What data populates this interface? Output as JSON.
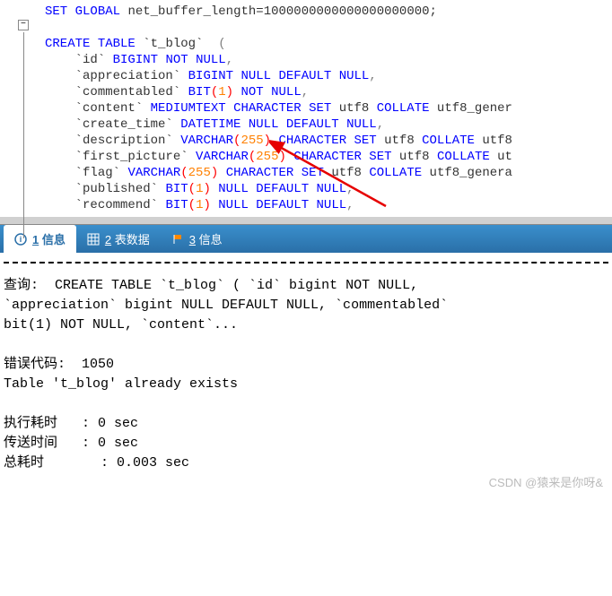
{
  "code": {
    "line1": {
      "set": "SET",
      "global": "GLOBAL",
      "var": "net_buffer_length",
      "val": "1000000000000000000000;"
    },
    "line2": "",
    "line3": {
      "create": "CREATE",
      "table": "TABLE",
      "name": "`t_blog`",
      "paren": "("
    },
    "line4": {
      "col": "`id`",
      "type": "BIGINT",
      "not": "NOT",
      "null": "NULL",
      "comma": ","
    },
    "line5": {
      "col": "`appreciation`",
      "type": "BIGINT",
      "null1": "NULL",
      "default": "DEFAULT",
      "null2": "NULL",
      "comma": ","
    },
    "line6": {
      "col": "`commentabled`",
      "type": "BIT",
      "num": "1",
      "not": "NOT",
      "null": "NULL",
      "comma": ","
    },
    "line7": {
      "col": "`content`",
      "type": "MEDIUMTEXT",
      "charset": "CHARACTER SET",
      "utf8": "utf8",
      "collate": "COLLATE",
      "coll": "utf8_gener"
    },
    "line8": {
      "col": "`create_time`",
      "type": "DATETIME",
      "null1": "NULL",
      "default": "DEFAULT",
      "null2": "NULL",
      "comma": ","
    },
    "line9": {
      "col": "`description`",
      "type": "VARCHAR",
      "num": "255",
      "charset": "CHARACTER SET",
      "utf8": "utf8",
      "collate": "COLLATE",
      "coll": "utf8"
    },
    "line10": {
      "col": "`first_picture`",
      "type": "VARCHAR",
      "num": "255",
      "charset": "CHARACTER SET",
      "utf8": "utf8",
      "collate": "COLLATE",
      "coll": "ut"
    },
    "line11": {
      "col": "`flag`",
      "type": "VARCHAR",
      "num": "255",
      "charset": "CHARACTER SET",
      "utf8": "utf8",
      "collate": "COLLATE",
      "coll": "utf8_genera"
    },
    "line12": {
      "col": "`published`",
      "type": "BIT",
      "num": "1",
      "null1": "NULL",
      "default": "DEFAULT",
      "null2": "NULL",
      "comma": ","
    },
    "line13": {
      "col": "`recommend`",
      "type": "BIT",
      "num": "1",
      "null1": "NULL",
      "default": "DEFAULT",
      "null2": "NULL",
      "comma": ","
    }
  },
  "tabs": {
    "tab1": {
      "num": "1",
      "label": "信息"
    },
    "tab2": {
      "num": "2",
      "label": "表数据"
    },
    "tab3": {
      "num": "3",
      "label": "信息"
    }
  },
  "output": {
    "query_label": "查询:",
    "query_text": "  CREATE TABLE `t_blog` ( `id` bigint NOT NULL,\n`appreciation` bigint NULL DEFAULT NULL, `commentabled`\nbit(1) NOT NULL, `content`...",
    "error_label": "错误代码:",
    "error_code": "1050",
    "error_msg": "Table 't_blog' already exists",
    "exec_label": "执行耗时",
    "exec_val": "0 sec",
    "send_label": "传送时间",
    "send_val": "0 sec",
    "total_label": "总耗时",
    "total_val": "0.003 sec"
  },
  "watermark": "CSDN @猿来是你呀&"
}
